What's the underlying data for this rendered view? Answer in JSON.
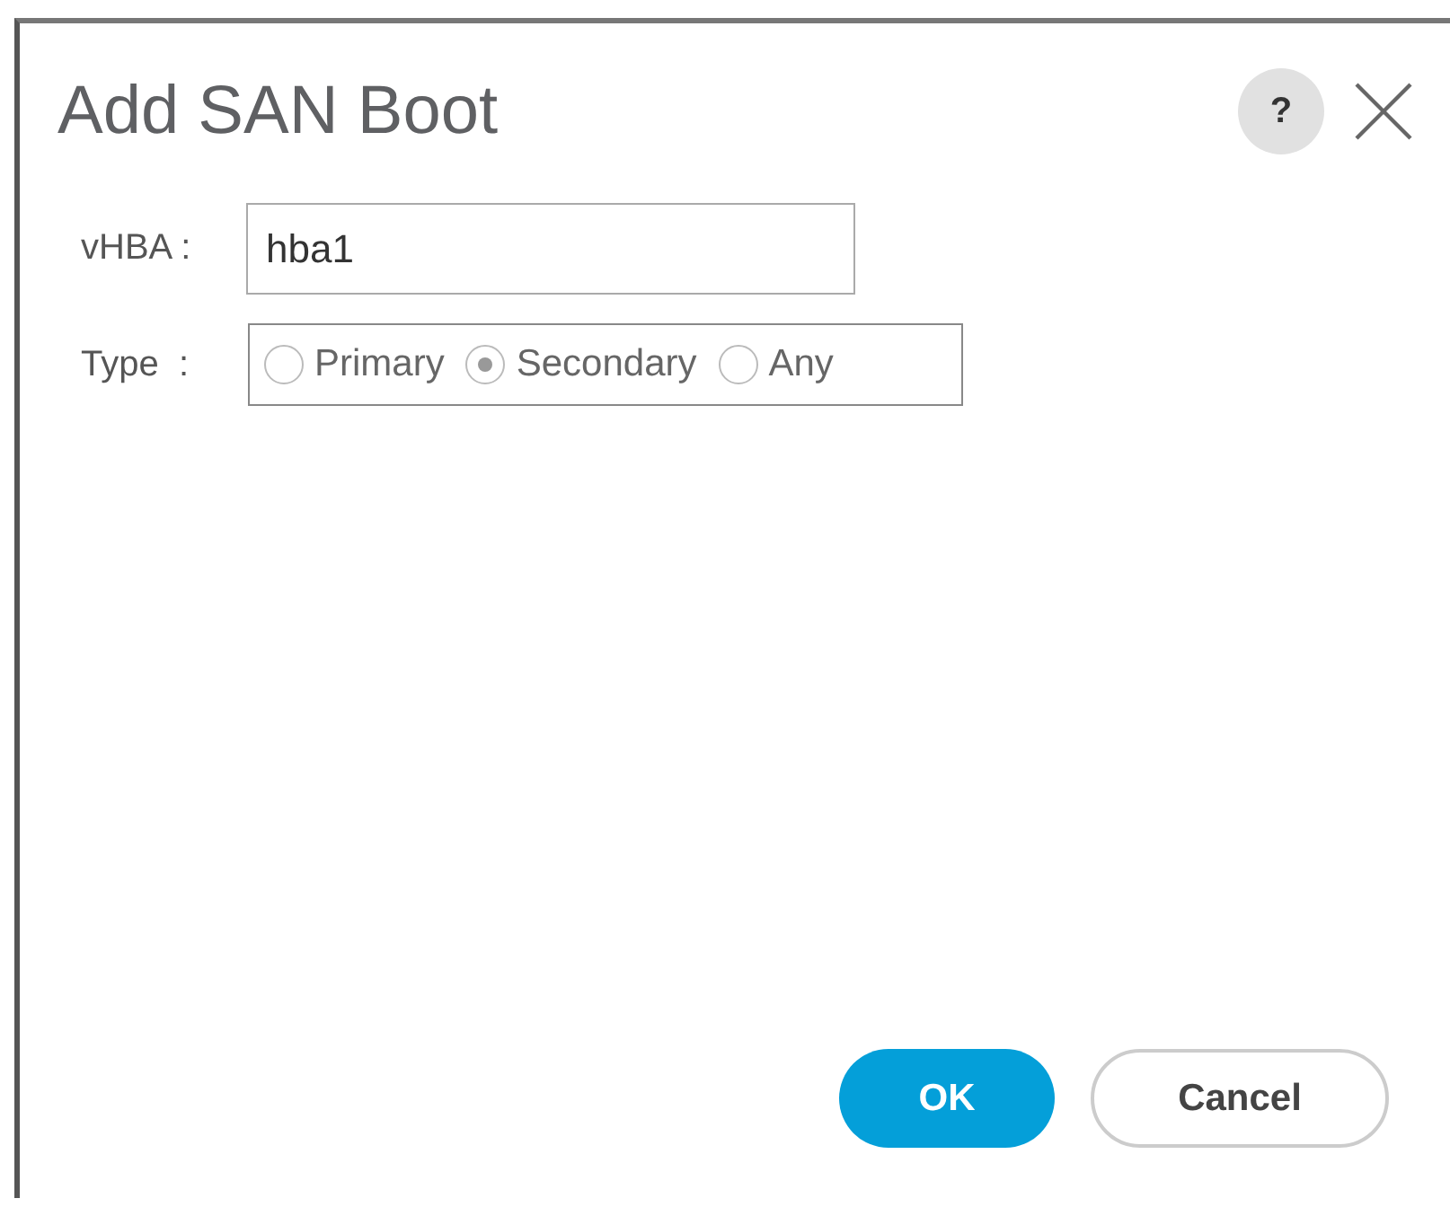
{
  "dialog": {
    "title": "Add SAN Boot",
    "help": "?"
  },
  "vhba": {
    "label": "vHBA :",
    "value": "hba1"
  },
  "type": {
    "label": "Type  :",
    "options": [
      {
        "label": "Primary",
        "selected": false
      },
      {
        "label": "Secondary",
        "selected": true
      },
      {
        "label": "Any",
        "selected": false
      }
    ]
  },
  "buttons": [
    {
      "label": "OK",
      "kind": "primary"
    },
    {
      "label": "Cancel",
      "kind": "secondary"
    }
  ]
}
